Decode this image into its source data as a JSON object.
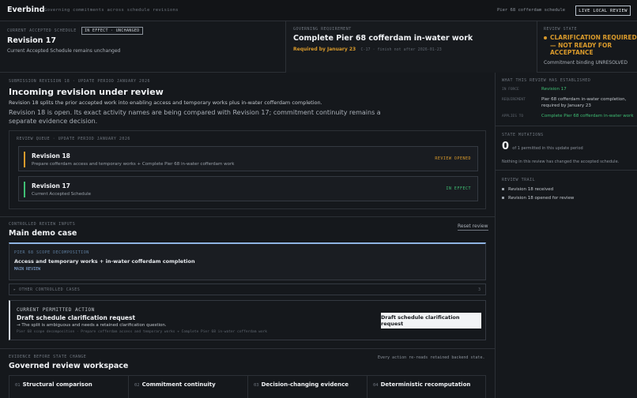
{
  "app": {
    "name": "Everbind",
    "tagline": "Governing commitments across schedule revisions"
  },
  "topbar": {
    "schedule": "Pier 68 cofferdam schedule",
    "live_button": "LIVE LOCAL REVIEW"
  },
  "current_schedule": {
    "label": "CURRENT ACCEPTED SCHEDULE",
    "badge": "IN EFFECT · UNCHANGED",
    "revision": "Revision 17",
    "note": "Current Accepted Schedule remains unchanged"
  },
  "governing": {
    "label": "GOVERNING REQUIREMENT",
    "title": "Complete Pier 68 cofferdam in-water work",
    "deadline": "Required by January 23",
    "detail": "C-17 · finish not after 2026-01-23"
  },
  "review_state": {
    "label": "REVIEW STATE",
    "line1": "CLARIFICATION REQUIRED",
    "line2": "— NOT READY FOR",
    "line3": "ACCEPTANCE",
    "binding": "Commitment binding UNRESOLVED"
  },
  "submission": {
    "label": "SUBMISSION REVISION 18 · UPDATE PERIOD JANUARY 2026",
    "title": "Incoming revision under review",
    "summary": "Revision 18 splits the prior accepted work into enabling access and temporary works plus in-water cofferdam completion.",
    "status_line1": "Revision 18 is open. Its exact activity names are being compared with Revision 17; commitment continuity remains a",
    "status_line2": "separate evidence decision."
  },
  "queue": {
    "label": "REVIEW QUEUE · UPDATE PERIOD JANUARY 2026",
    "items": [
      {
        "title": "Revision 18",
        "subtitle": "Prepare cofferdam access and temporary works + Complete Pier 68 in-water cofferdam work",
        "state": "REVIEW OPENED"
      },
      {
        "title": "Revision 17",
        "subtitle": "Current Accepted Schedule",
        "state": "IN EFFECT"
      }
    ]
  },
  "inputs": {
    "label": "CONTROLLED REVIEW INPUTS",
    "title": "Main demo case",
    "reset": "Reset review"
  },
  "scope": {
    "label": "PIER 68 SCOPE DECOMPOSITION",
    "title": "Access and temporary works + in-water cofferdam completion",
    "tag": "MAIN REVIEW"
  },
  "other_cases": {
    "label": "▸ OTHER CONTROLLED CASES",
    "count": "3"
  },
  "action": {
    "label": "CURRENT PERMITTED ACTION",
    "title": "Draft schedule clarification request",
    "reason": "→ The split is ambiguous and needs a retained clarification question.",
    "trace": "Pier 68 scope decomposition · Prepare cofferdam access and temporary works + Complete Pier 68 in-water cofferdam work",
    "button": "Draft schedule clarification request"
  },
  "evidence": {
    "label": "EVIDENCE BEFORE STATE CHANGE",
    "title": "Governed review workspace",
    "note": "Every action re-reads retained backend state.",
    "cards": [
      {
        "num": "01",
        "title": "Structural comparison"
      },
      {
        "num": "02",
        "title": "Commitment continuity"
      },
      {
        "num": "03",
        "title": "Decision-changing evidence"
      },
      {
        "num": "04",
        "title": "Deterministic recomputation"
      }
    ]
  },
  "established": {
    "label": "WHAT THIS REVIEW HAS ESTABLISHED",
    "rows": [
      {
        "key": "IN FORCE",
        "value": "Revision 17"
      },
      {
        "key": "REQUIREMENT",
        "value": "Pier 68 cofferdam in-water completion, required by January 23"
      },
      {
        "key": "APPLIES TO",
        "value": "Complete Pier 68 cofferdam in-water work"
      }
    ]
  },
  "mutations": {
    "label": "STATE MUTATIONS",
    "count": "0",
    "of_text": "of 1 permitted in this update period",
    "note": "Nothing in this review has changed the accepted schedule."
  },
  "trail": {
    "label": "REVIEW TRAIL",
    "items": [
      "Revision 18 received",
      "Revision 18 opened for review"
    ]
  },
  "colors": {
    "accent_warn": "#d99a2b",
    "accent_green": "#3fbf74",
    "accent_blue": "#8fb4e3"
  }
}
